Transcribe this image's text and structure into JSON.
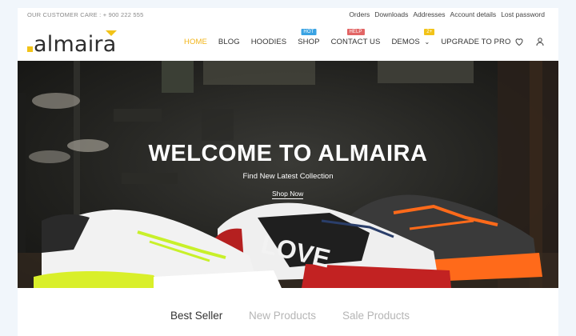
{
  "topbar": {
    "customer_care": "OUR CUSTOMER CARE : + 900 222 555",
    "links": [
      "Orders",
      "Downloads",
      "Addresses",
      "Account details",
      "Lost password"
    ]
  },
  "logo": {
    "text": "almaira"
  },
  "nav": {
    "items": [
      {
        "label": "HOME",
        "badge": "",
        "active": true
      },
      {
        "label": "BLOG",
        "badge": ""
      },
      {
        "label": "HOODIES",
        "badge": ""
      },
      {
        "label": "SHOP",
        "badge": "HOT"
      },
      {
        "label": "CONTACT US",
        "badge": "HELP"
      },
      {
        "label": "DEMOS",
        "badge": "2+"
      },
      {
        "label": "UPGRADE TO PRO",
        "badge": ""
      }
    ],
    "demos_chevron": "⌄"
  },
  "icons": {
    "wishlist": "heart-icon",
    "account": "user-icon"
  },
  "hero": {
    "title": "WELCOME TO ALMAIRA",
    "subtitle": "Find New Latest Collection",
    "button": "Shop Now",
    "shoe_text": "LOVE"
  },
  "tabs": [
    "Best Seller",
    "New Products",
    "Sale Products"
  ],
  "colors": {
    "accent": "#f2c318",
    "badge_hot": "#3aa3e3",
    "badge_help": "#e26565",
    "page_background": "#f1f6fb"
  }
}
